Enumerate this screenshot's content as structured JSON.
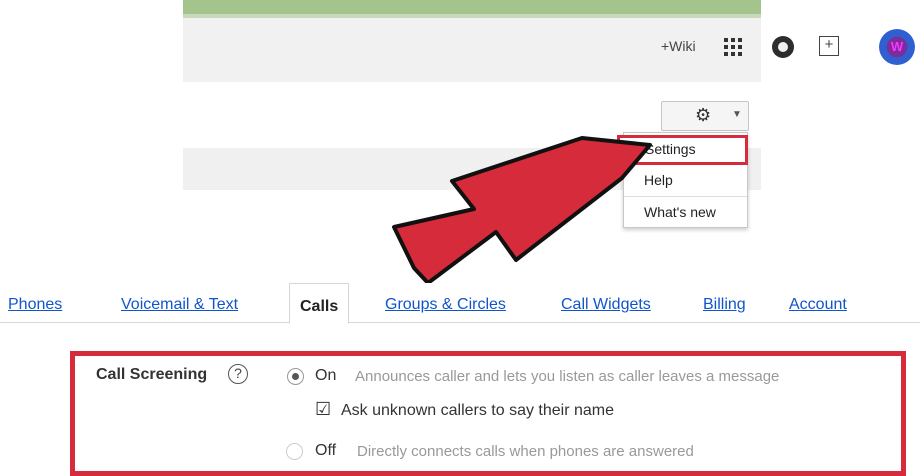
{
  "header": {
    "wiki_label": "+Wiki",
    "icons": [
      "apps-icon",
      "notifications-icon",
      "share-icon"
    ],
    "avatar_initial": "W"
  },
  "settings_menu": {
    "button_icon": "gear-icon",
    "items": [
      {
        "label": "Settings",
        "highlighted": true
      },
      {
        "label": "Help"
      },
      {
        "label": "What's new"
      }
    ]
  },
  "tabs": [
    {
      "label": "Phones"
    },
    {
      "label": "Voicemail & Text"
    },
    {
      "label": "Calls",
      "active": true
    },
    {
      "label": "Groups & Circles"
    },
    {
      "label": "Call Widgets"
    },
    {
      "label": "Billing"
    },
    {
      "label": "Account"
    }
  ],
  "call_screening": {
    "label": "Call Screening",
    "help_glyph": "?",
    "on_label": "On",
    "on_desc": "Announces caller and lets you listen as caller leaves a message",
    "checkbox_label": "Ask unknown callers to say their name",
    "checkbox_checked": true,
    "off_label": "Off",
    "off_desc": "Directly connects calls when phones are answered",
    "selected": "On"
  },
  "colors": {
    "highlight_red": "#d62b3b",
    "link_blue": "#1155cc",
    "top_accent_green": "#a3c48c"
  }
}
